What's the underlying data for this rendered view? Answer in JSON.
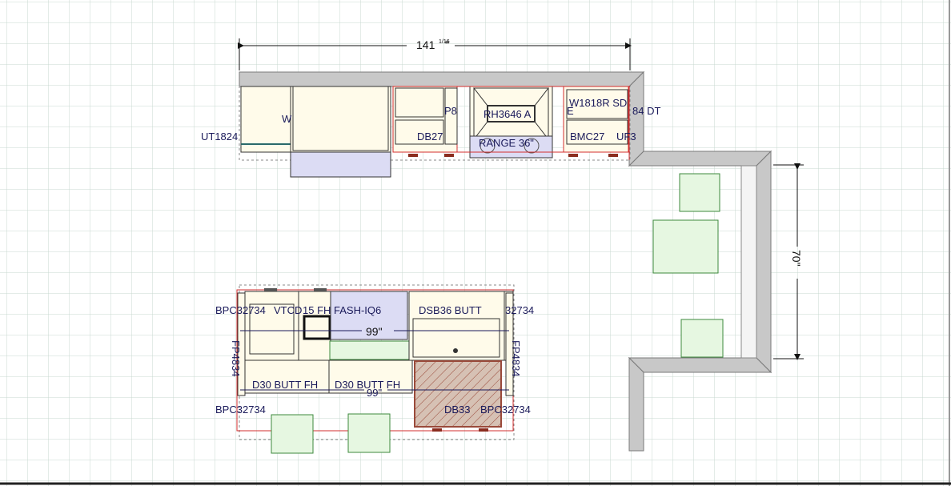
{
  "dimensions": {
    "top_width": "141",
    "top_width_fraction": "1/16",
    "top_width_unit": "\"",
    "right_depth": "70\"",
    "island_inner": "99\"",
    "island_overlap": "99\""
  },
  "labels": {
    "ut1824": "UT1824",
    "w_partial": "W",
    "p8_partial": "P8",
    "rh3646a": "RH3646 A",
    "w1818r_sd": "W1818R SD",
    "e_partial": "E",
    "b84_dt": "84 DT",
    "db27": "DB27",
    "range_partial": "RANGE 36\"",
    "bmc27": "BMC27",
    "uf3": "UF3",
    "bpc_top_left": "BPC32734",
    "vtcd_partial": "VTCD",
    "fh_fash": "15 FH FASH-IQ6",
    "dsb36": "DSB36 BUTT",
    "bpc_top_right_partial": "32734",
    "fp_left": "FP4834",
    "fp_right": "FP4834",
    "d30_left": "D30 BUTT FH",
    "d30_right": "D30 BUTT FH",
    "db33": "DB33",
    "bpc_bottom_left": "BPC32734",
    "bpc_bottom_right": "BPC32734"
  },
  "colors": {
    "grid": "#c9d8d0",
    "wall": "#c8c8c8",
    "wall_stroke": "#7a7a7a",
    "cabinet": "#fffbea",
    "appliance": "#dcdcf4",
    "stool": "#e6f7e1",
    "stool_stroke": "#3d8a3d",
    "outline_red": "#d32f2f",
    "counter_hatch": "#d6c1b4",
    "text": "#1a1a5a"
  }
}
